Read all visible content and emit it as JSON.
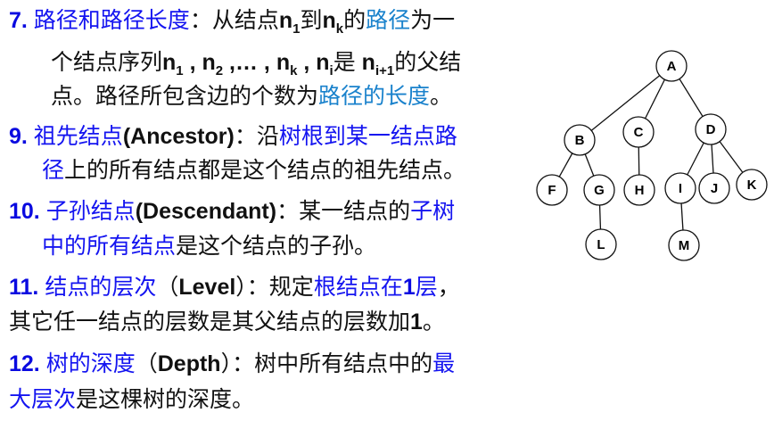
{
  "lines": [
    {
      "segs": [
        {
          "t": "7.  ",
          "c": "n"
        },
        {
          "t": "路径和路径长度",
          "c": "b"
        },
        {
          "t": "：从结点",
          "c": "k"
        },
        {
          "t": "n",
          "c": "kb"
        },
        {
          "t": "1",
          "c": "kb",
          "sub": true
        },
        {
          "t": "到",
          "c": "k"
        },
        {
          "t": "n",
          "c": "kb"
        },
        {
          "t": "k",
          "c": "kb",
          "sub": true
        },
        {
          "t": "的",
          "c": "k"
        },
        {
          "t": "路径",
          "c": "lb"
        },
        {
          "t": "为一",
          "c": "k"
        }
      ]
    },
    {
      "segs": [
        {
          "t": "个结点序列",
          "c": "k"
        },
        {
          "t": "n",
          "c": "kb"
        },
        {
          "t": "1",
          "c": "kb",
          "sub": true
        },
        {
          "t": " , n",
          "c": "kb"
        },
        {
          "t": "2",
          "c": "kb",
          "sub": true
        },
        {
          "t": " ,… , n",
          "c": "kb"
        },
        {
          "t": "k",
          "c": "kb",
          "sub": true
        },
        {
          "t": " , n",
          "c": "kb"
        },
        {
          "t": "i",
          "c": "kb",
          "sub": true
        },
        {
          "t": "是 ",
          "c": "k"
        },
        {
          "t": "n",
          "c": "kb"
        },
        {
          "t": "i+1",
          "c": "kb",
          "sub": true
        },
        {
          "t": "的父结",
          "c": "k"
        }
      ]
    },
    {
      "segs": [
        {
          "t": "点。路径所包含边的个数为",
          "c": "k"
        },
        {
          "t": "路径的长度",
          "c": "lb"
        },
        {
          "t": "。",
          "c": "k"
        }
      ]
    },
    {
      "segs": [
        {
          "t": "9. ",
          "c": "n"
        },
        {
          "t": "祖先结点",
          "c": "b"
        },
        {
          "t": "(Ancestor)",
          "c": "kb"
        },
        {
          "t": "：沿",
          "c": "k"
        },
        {
          "t": "树根到某一结点路",
          "c": "b"
        }
      ]
    },
    {
      "segs": [
        {
          "t": "径",
          "c": "b"
        },
        {
          "t": "上的所有结点都是这个结点的祖先结点。",
          "c": "k"
        }
      ]
    },
    {
      "segs": [
        {
          "t": "10.  ",
          "c": "n"
        },
        {
          "t": "子孙结点",
          "c": "b"
        },
        {
          "t": "(Descendant)",
          "c": "kb"
        },
        {
          "t": "：某一结点的",
          "c": "k"
        },
        {
          "t": "子树",
          "c": "b"
        }
      ]
    },
    {
      "segs": [
        {
          "t": "中的所有结点",
          "c": "b"
        },
        {
          "t": "是这个结点的子孙。",
          "c": "k"
        }
      ]
    },
    {
      "segs": [
        {
          "t": "11. ",
          "c": "n"
        },
        {
          "t": "结点的层次",
          "c": "b"
        },
        {
          "t": "（",
          "c": "k"
        },
        {
          "t": "Level",
          "c": "kb"
        },
        {
          "t": "）：规定",
          "c": "k"
        },
        {
          "t": "根结点在",
          "c": "b"
        },
        {
          "t": "1",
          "c": "n"
        },
        {
          "t": "层",
          "c": "b"
        },
        {
          "t": "，",
          "c": "k"
        }
      ]
    },
    {
      "segs": [
        {
          "t": "其它任一结点的层数是其父结点的层数加",
          "c": "k"
        },
        {
          "t": "1",
          "c": "kb"
        },
        {
          "t": "。",
          "c": "k"
        }
      ]
    },
    {
      "segs": [
        {
          "t": "12. ",
          "c": "n"
        },
        {
          "t": "树的深度",
          "c": "b"
        },
        {
          "t": "（",
          "c": "k"
        },
        {
          "t": "Depth",
          "c": "kb"
        },
        {
          "t": "）：树中所有结点中的",
          "c": "k"
        },
        {
          "t": "最",
          "c": "b"
        }
      ]
    },
    {
      "segs": [
        {
          "t": "大层次",
          "c": "b"
        },
        {
          "t": "是这棵树的深度。",
          "c": "k"
        }
      ]
    }
  ],
  "tree": {
    "nodes": [
      "A",
      "B",
      "C",
      "D",
      "F",
      "G",
      "H",
      "I",
      "J",
      "K",
      "L",
      "M"
    ],
    "edges": [
      [
        "A",
        "B"
      ],
      [
        "A",
        "C"
      ],
      [
        "A",
        "D"
      ],
      [
        "B",
        "F"
      ],
      [
        "B",
        "G"
      ],
      [
        "C",
        "H"
      ],
      [
        "D",
        "I"
      ],
      [
        "D",
        "J"
      ],
      [
        "D",
        "K"
      ],
      [
        "G",
        "L"
      ],
      [
        "I",
        "M"
      ]
    ]
  }
}
